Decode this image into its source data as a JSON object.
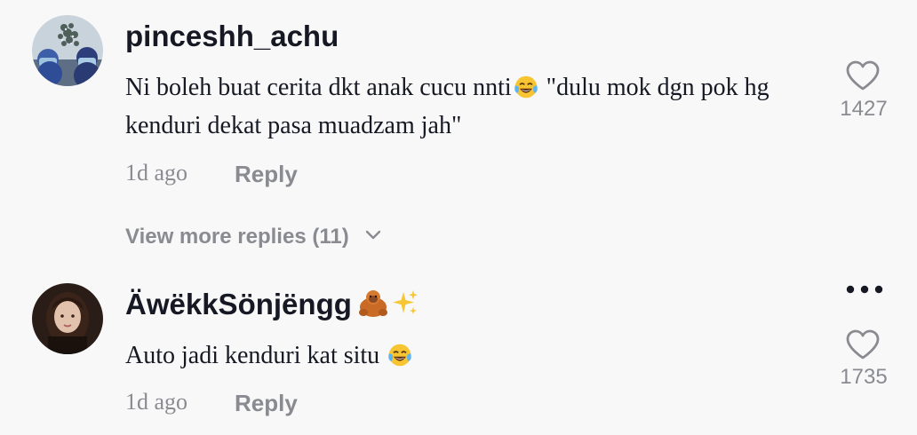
{
  "comments": [
    {
      "username": "pinceshh_achu",
      "text_part1": "Ni boleh buat cerita dkt anak cucu nnti",
      "text_emoji": "face-with-tears-of-joy",
      "text_part2": " \"dulu mok dgn pok hg kenduri dekat pasa muadzam jah\"",
      "time": "1d ago",
      "reply_label": "Reply",
      "like_count": "1427",
      "view_more_replies": "View more replies (11)"
    },
    {
      "username": "ÄwëkkSönjëngg",
      "username_emojis": [
        "orangutan",
        "sparkles"
      ],
      "text_part1": "Auto jadi kenduri kat situ ",
      "text_emoji": "face-with-tears-of-joy",
      "time": "1d ago",
      "reply_label": "Reply",
      "like_count": "1735"
    }
  ],
  "colors": {
    "background": "#f8f8f8",
    "primary_text": "#161823",
    "secondary_text": "#8a8b91"
  }
}
